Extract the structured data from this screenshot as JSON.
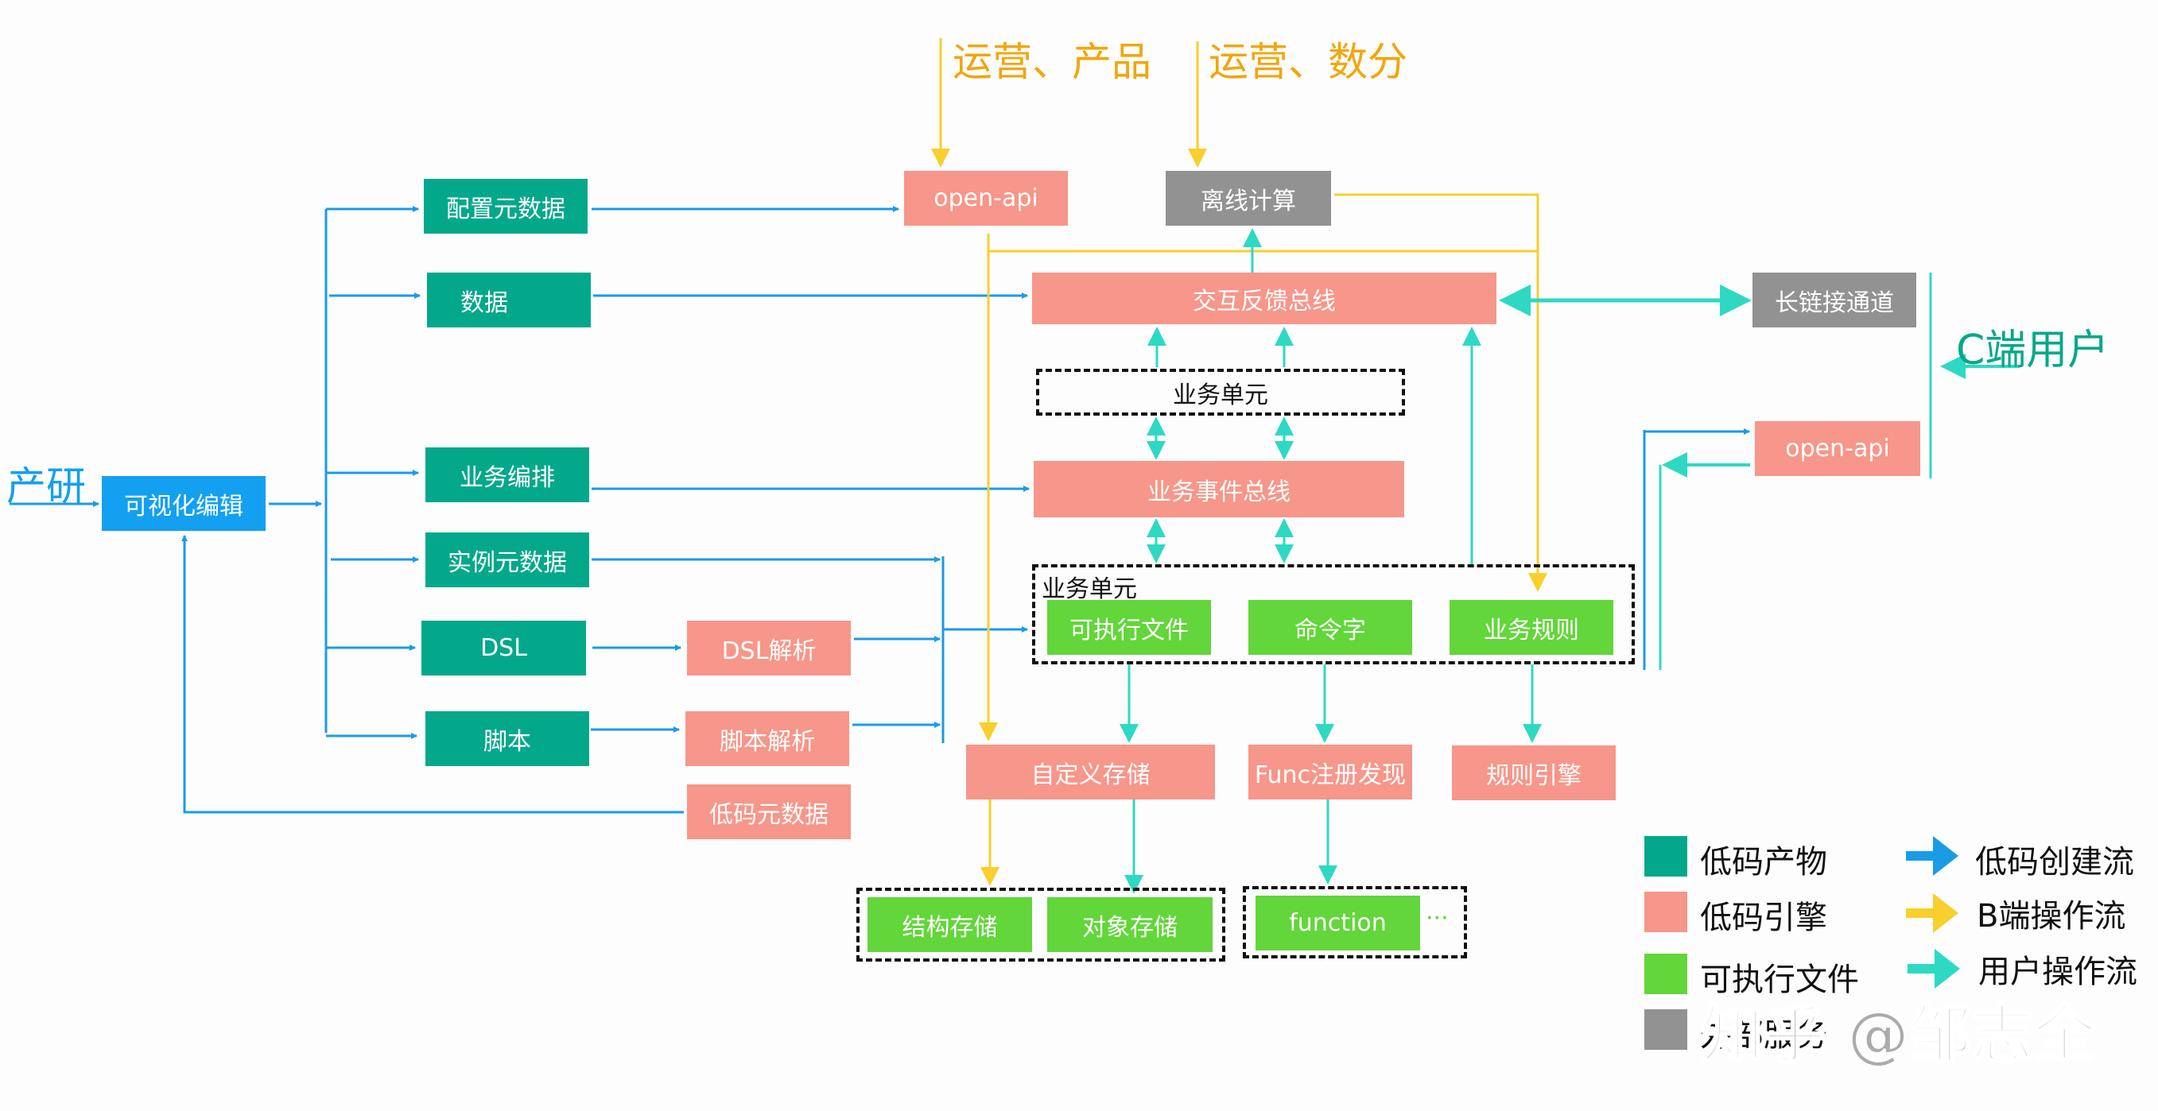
{
  "colors": {
    "low_code_artifact": "#03a88a",
    "low_code_engine": "#f7968a",
    "executable": "#62d63a",
    "external_service": "#929292",
    "creation_flow": "#1a9be6",
    "b_side_flow": "#f8cf2c",
    "user_flow": "#2ed9c3"
  },
  "actors": {
    "rd": "产研",
    "ops_product": "运营、产品",
    "ops_analytics": "运营、数分",
    "c_user": "C端用户"
  },
  "nodes": {
    "visual_editor": "可视化编辑",
    "config_metadata": "配置元数据",
    "data": "数据",
    "biz_orchestration": "业务编排",
    "instance_metadata": "实例元数据",
    "dsl": "DSL",
    "script": "脚本",
    "dsl_parse": "DSL解析",
    "script_parse": "脚本解析",
    "lowcode_metadata": "低码元数据",
    "open_api_top": "open-api",
    "offline_compute": "离线计算",
    "interaction_bus": "交互反馈总线",
    "long_conn": "长链接通道",
    "biz_unit_small": "业务单元",
    "biz_event_bus": "业务事件总线",
    "biz_unit_group": "业务单元",
    "executable_file": "可执行文件",
    "command_word": "命令字",
    "biz_rule": "业务规则",
    "custom_storage": "自定义存储",
    "func_registry": "Func注册发现",
    "rule_engine": "规则引擎",
    "struct_storage": "结构存储",
    "object_storage": "对象存储",
    "function": "function",
    "ellipsis": "···",
    "open_api_right": "open-api"
  },
  "legend": {
    "items": [
      {
        "label": "低码产物",
        "color": "#03a88a"
      },
      {
        "label": "低码引擎",
        "color": "#f7968a"
      },
      {
        "label": "可执行文件",
        "color": "#62d63a"
      },
      {
        "label": "外部服务",
        "color": "#929292"
      }
    ],
    "flows": [
      {
        "label": "低码创建流",
        "color": "#1a9be6"
      },
      {
        "label": "B端操作流",
        "color": "#f8cf2c"
      },
      {
        "label": "用户操作流",
        "color": "#2ed9c3"
      }
    ]
  },
  "watermark": "知乎 @邹志全"
}
